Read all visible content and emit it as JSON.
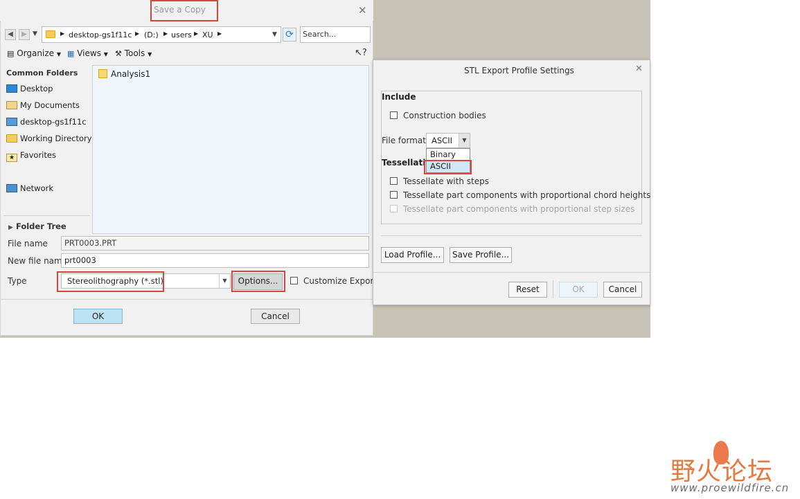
{
  "save_dialog": {
    "title": "Save a Copy",
    "search_placeholder": "Search...",
    "breadcrumb": [
      "desktop-gs1f11c",
      "(D:)",
      "users",
      "XU"
    ],
    "toolbar": {
      "organize": "Organize",
      "views": "Views",
      "tools": "Tools"
    },
    "sidebar": {
      "heading": "Common Folders",
      "items": [
        "Desktop",
        "My Documents",
        "desktop-gs1f11c",
        "Working Directory",
        "Favorites",
        "Network"
      ],
      "folder_tree": "Folder Tree"
    },
    "files": [
      "Analysis1"
    ],
    "file_name_label": "File name",
    "file_name_value": "PRT0003.PRT",
    "new_file_name_label": "New file name",
    "new_file_name_value": "prt0003",
    "type_label": "Type",
    "type_value": "Stereolithography (*.stl)",
    "options_button": "Options...",
    "customize_export": "Customize Export",
    "ok": "OK",
    "cancel": "Cancel"
  },
  "stl_dialog": {
    "title": "STL Export Profile Settings",
    "include_heading": "Include",
    "construction_bodies": "Construction bodies",
    "file_format_label": "File format",
    "file_format_value": "ASCII",
    "file_format_options": [
      "Binary",
      "ASCII"
    ],
    "tessellation_heading": "Tessellation",
    "tessellate_steps": "Tessellate with steps",
    "tessellate_chord": "Tessellate part components with proportional chord heights",
    "tessellate_step_sizes": "Tessellate part components with proportional step sizes",
    "load_profile": "Load Profile...",
    "save_profile": "Save Profile...",
    "reset": "Reset",
    "ok": "OK",
    "cancel": "Cancel"
  },
  "watermark": {
    "chinese": "野火论坛",
    "url": "www.proewildfire.cn"
  },
  "colors": {
    "highlight_red": "#d9453c",
    "primary_button": "#bde2f3",
    "folder_yellow": "#f2cd5c"
  }
}
